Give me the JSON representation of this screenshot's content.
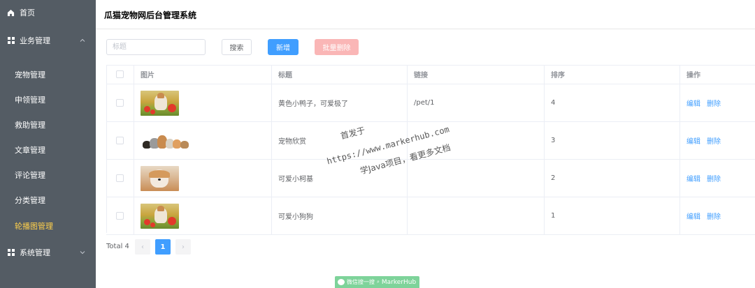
{
  "sidebar": {
    "home": "首页",
    "business": "业务管理",
    "system": "系统管理",
    "sub_items": [
      {
        "label": "宠物管理",
        "active": false
      },
      {
        "label": "申领管理",
        "active": false
      },
      {
        "label": "救助管理",
        "active": false
      },
      {
        "label": "文章管理",
        "active": false
      },
      {
        "label": "评论管理",
        "active": false
      },
      {
        "label": "分类管理",
        "active": false
      },
      {
        "label": "轮播图管理",
        "active": true
      }
    ],
    "colors": {
      "background": "#545c64",
      "text": "#ffffff",
      "active": "#ffd04b"
    }
  },
  "header": {
    "title": "瓜猫宠物网后台管理系统"
  },
  "toolbar": {
    "search_placeholder": "标题",
    "search_value": "",
    "search_label": "搜索",
    "add_label": "新增",
    "batch_delete_label": "批量删除"
  },
  "table": {
    "columns": [
      "图片",
      "标题",
      "链接",
      "排序",
      "操作"
    ],
    "rows": [
      {
        "image": "puppy-in-flowers",
        "title": "黄色小鸭子，可爱极了",
        "link": "/pet/1",
        "sort": "4"
      },
      {
        "image": "group-of-pets",
        "title": "宠物欣赏",
        "link": "",
        "sort": "3"
      },
      {
        "image": "corgi-puppy",
        "title": "可爱小柯基",
        "link": "",
        "sort": "2"
      },
      {
        "image": "puppy-in-flowers",
        "title": "可爱小狗狗",
        "link": "",
        "sort": "1"
      }
    ],
    "actions": {
      "edit": "编辑",
      "delete": "删除"
    }
  },
  "pagination": {
    "total": "Total 4",
    "current_page": "1",
    "prev": "‹",
    "next": "›"
  },
  "watermark": {
    "line1": "首发于",
    "line2": "https://www.markerhub.com",
    "line3": "学Java项目，看更多文档",
    "wechat_text": "微信搜一搜",
    "wechat_brand": "MarkerHub"
  },
  "colors": {
    "primary": "#409eff",
    "danger_disabled": "#fab6b6",
    "border": "#ebeef5"
  }
}
